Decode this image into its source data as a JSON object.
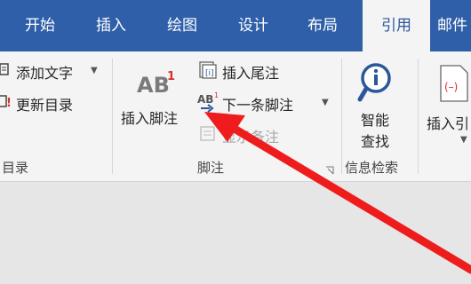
{
  "tabs": [
    {
      "label": "开始"
    },
    {
      "label": "插入"
    },
    {
      "label": "绘图"
    },
    {
      "label": "设计"
    },
    {
      "label": "布局"
    },
    {
      "label": "引用"
    },
    {
      "label": "邮件"
    }
  ],
  "active_tab": "引用",
  "groups": {
    "toc": {
      "add_text": "添加文字",
      "update_toc": "更新目录",
      "label": "目录"
    },
    "footnotes": {
      "insert_footnote": "插入脚注",
      "insert_endnote": "插入尾注",
      "next_footnote": "下一条脚注",
      "show_notes": "显示备注",
      "label": "脚注",
      "footnote_icon_text": "AB",
      "footnote_superscript": "1"
    },
    "research": {
      "smart_lookup_line1": "智能",
      "smart_lookup_line2": "查找",
      "label": "信息检索"
    },
    "citations": {
      "insert_citation": "插入引"
    }
  },
  "colors": {
    "tabbar": "#2e5fa8",
    "active_tab_text": "#2b579a",
    "annotation_arrow": "#ee1c1c"
  }
}
